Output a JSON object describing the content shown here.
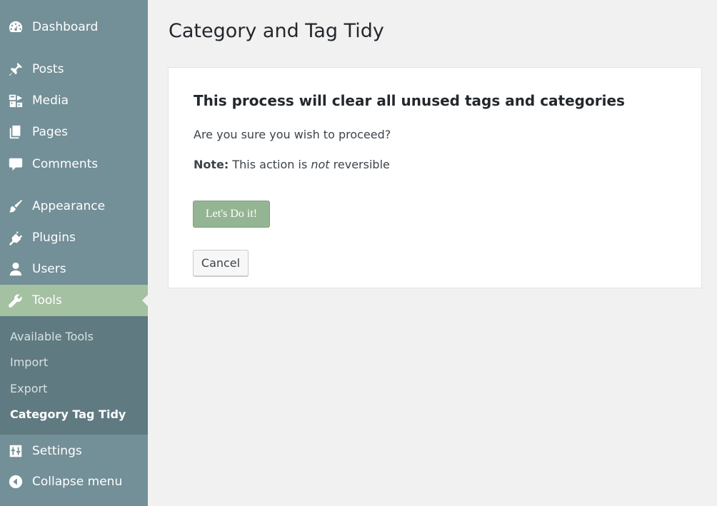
{
  "sidebar": {
    "items": [
      {
        "label": "Dashboard",
        "icon": "dashboard-icon"
      },
      {
        "label": "Posts",
        "icon": "pin-icon"
      },
      {
        "label": "Media",
        "icon": "media-icon"
      },
      {
        "label": "Pages",
        "icon": "pages-icon"
      },
      {
        "label": "Comments",
        "icon": "comment-icon"
      },
      {
        "label": "Appearance",
        "icon": "paintbrush-icon"
      },
      {
        "label": "Plugins",
        "icon": "plugin-icon"
      },
      {
        "label": "Users",
        "icon": "user-icon"
      },
      {
        "label": "Tools",
        "icon": "wrench-icon",
        "active": true
      },
      {
        "label": "Settings",
        "icon": "sliders-icon"
      },
      {
        "label": "Collapse menu",
        "icon": "collapse-arrow-icon"
      }
    ],
    "submenu": [
      {
        "label": "Available Tools"
      },
      {
        "label": "Import"
      },
      {
        "label": "Export"
      },
      {
        "label": "Category Tag Tidy",
        "current": true
      }
    ]
  },
  "page": {
    "title": "Category and Tag Tidy"
  },
  "card": {
    "heading": "This process will clear all unused tags and categories",
    "question": "Are you sure you wish to proceed?",
    "note_label": "Note:",
    "note_prefix": "This action is",
    "note_emphasis": "not",
    "note_suffix": "reversible",
    "confirm_label": "Let's Do it!",
    "cancel_label": "Cancel"
  },
  "colors": {
    "sidebar_bg": "#738f97",
    "submenu_bg": "#5f7a80",
    "active_bg": "#a4c1a2",
    "confirm_bg": "#94b593"
  }
}
